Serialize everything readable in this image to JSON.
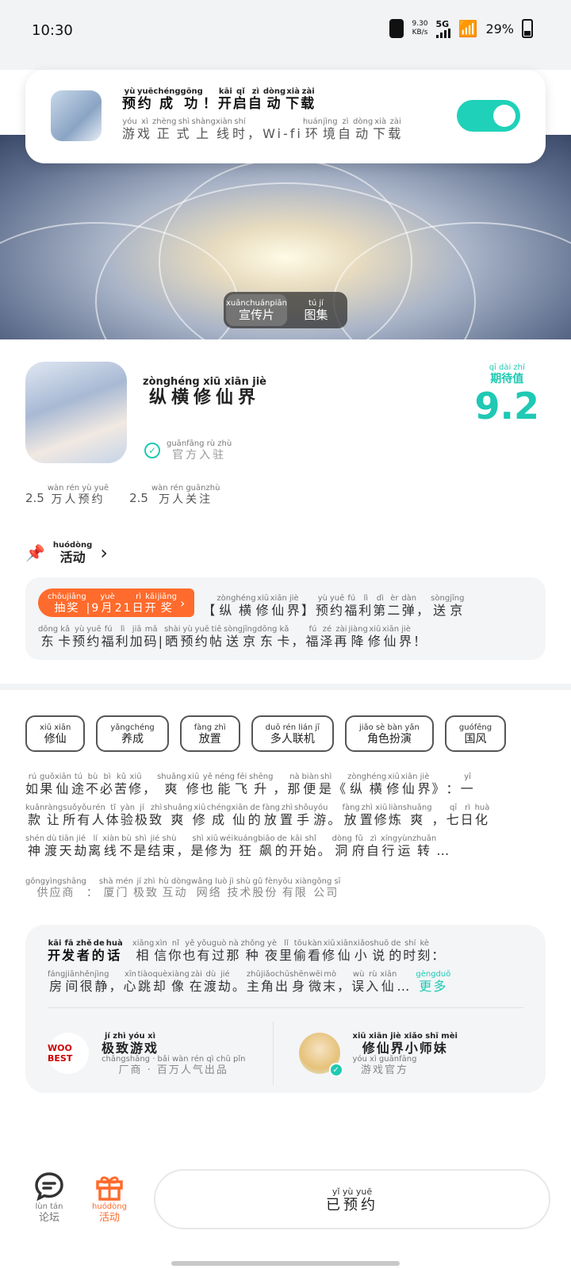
{
  "status_bar": {
    "time": "10:30",
    "net_speed": "9.30",
    "net_unit": "KB/s",
    "network": "5G",
    "battery": "29%"
  },
  "toast": {
    "title": [
      [
        "yù",
        "预"
      ],
      [
        "yuē",
        "约"
      ],
      [
        "chéng",
        "成"
      ],
      [
        "gōng",
        "功"
      ],
      [
        "",
        "！"
      ],
      [
        "kāi",
        "开"
      ],
      [
        "qǐ",
        "启"
      ],
      [
        "zì",
        "自"
      ],
      [
        "dòng",
        "动"
      ],
      [
        "xià",
        "下"
      ],
      [
        "zài",
        "载"
      ]
    ],
    "subtitle": [
      [
        "yóu",
        "游"
      ],
      [
        "xì",
        "戏"
      ],
      [
        "zhèng",
        "正"
      ],
      [
        "shì",
        "式"
      ],
      [
        "shàng",
        "上"
      ],
      [
        "xiàn",
        "线"
      ],
      [
        "shí",
        "时"
      ],
      [
        "",
        "，"
      ],
      [
        "",
        "Wi-fi"
      ],
      [
        "huán",
        "环"
      ],
      [
        "jìng",
        "境"
      ],
      [
        "zì",
        "自"
      ],
      [
        "dòng",
        "动"
      ],
      [
        "xià",
        "下"
      ],
      [
        "zài",
        "载"
      ]
    ],
    "toggle_on": true
  },
  "media_tabs": [
    {
      "pinyin": "xuānchuánpiān",
      "label": "宣传片"
    },
    {
      "pinyin": "tú jí",
      "label": "图集"
    }
  ],
  "game": {
    "name_pinyin": "zònghéng xiū xiān jiè",
    "name": "纵横修仙界",
    "official_pinyin": "guānfāng rù zhù",
    "official": "官方入驻",
    "expect_pinyin": "qī dài zhí",
    "expect_label": "期待值",
    "score": "9.2",
    "stats": [
      {
        "num": "2.5",
        "pinyin": "wàn rén yù yuē",
        "label": "万人预约"
      },
      {
        "num": "2.5",
        "pinyin": "wàn rén guānzhù",
        "label": "万人关注"
      }
    ]
  },
  "activity": {
    "pinyin": "huódòng",
    "title": "活动",
    "badge": [
      [
        "chōujiǎng",
        "抽奖"
      ],
      [
        "",
        "|"
      ],
      [
        "",
        "9"
      ],
      [
        "yuè",
        "月"
      ],
      [
        "",
        "21"
      ],
      [
        "rì",
        "日"
      ],
      [
        "kāi",
        "开"
      ],
      [
        "jiǎng",
        "奖"
      ]
    ],
    "line1": [
      [
        "",
        "【"
      ],
      [
        "zòng",
        "纵"
      ],
      [
        "héng",
        "横"
      ],
      [
        "xiū",
        "修"
      ],
      [
        "xiān",
        "仙"
      ],
      [
        "jiè",
        "界"
      ],
      [
        "",
        "】"
      ],
      [
        "yù",
        "预"
      ],
      [
        "yuē",
        "约"
      ],
      [
        "fú",
        "福"
      ],
      [
        "lì",
        "利"
      ],
      [
        "dì",
        "第"
      ],
      [
        "èr",
        "二"
      ],
      [
        "dàn",
        "弹"
      ],
      [
        "",
        "，"
      ],
      [
        "sòng",
        "送"
      ],
      [
        "jīng",
        "京"
      ]
    ],
    "line2": [
      [
        "dōng",
        "东"
      ],
      [
        "kǎ",
        "卡"
      ],
      [
        "yù",
        "预"
      ],
      [
        "yuē",
        "约"
      ],
      [
        "fú",
        "福"
      ],
      [
        "lì",
        "利"
      ],
      [
        "jiā",
        "加"
      ],
      [
        "mǎ",
        "码"
      ],
      [
        "",
        "|"
      ],
      [
        "shài",
        "晒"
      ],
      [
        "yù",
        "预"
      ],
      [
        "yuē",
        "约"
      ],
      [
        "tiē",
        "帖"
      ],
      [
        "sòng",
        "送"
      ],
      [
        "jīng",
        "京"
      ],
      [
        "dōng",
        "东"
      ],
      [
        "kǎ",
        "卡"
      ],
      [
        "",
        "，"
      ],
      [
        "fú",
        "福"
      ],
      [
        "zé",
        "泽"
      ],
      [
        "zài",
        "再"
      ],
      [
        "jiàng",
        "降"
      ],
      [
        "xiū",
        "修"
      ],
      [
        "xiān",
        "仙"
      ],
      [
        "jiè",
        "界"
      ],
      [
        "",
        "！"
      ]
    ]
  },
  "tags": [
    {
      "pinyin": "xiū xiān",
      "label": "修仙"
    },
    {
      "pinyin": "yǎngchéng",
      "label": "养成"
    },
    {
      "pinyin": "fàng zhì",
      "label": "放置"
    },
    {
      "pinyin": "duō rén lián jī",
      "label": "多人联机"
    },
    {
      "pinyin": "jiǎo sè bàn yǎn",
      "label": "角色扮演"
    },
    {
      "pinyin": "guófēng",
      "label": "国风"
    }
  ],
  "description": [
    [
      [
        "rú",
        "如"
      ],
      [
        "guǒ",
        "果"
      ],
      [
        "xiān",
        "仙"
      ],
      [
        "tú",
        "途"
      ],
      [
        "bù",
        "不"
      ],
      [
        "bì",
        "必"
      ],
      [
        "kǔ",
        "苦"
      ],
      [
        "xiū",
        "修"
      ],
      [
        "",
        "，"
      ],
      [
        "shuǎng",
        "爽"
      ],
      [
        "xiū",
        "修"
      ],
      [
        "yě",
        "也"
      ],
      [
        "néng",
        "能"
      ],
      [
        "fēi",
        "飞"
      ],
      [
        "shēng",
        "升"
      ],
      [
        "",
        "，"
      ],
      [
        "nà",
        "那"
      ],
      [
        "biàn",
        "便"
      ],
      [
        "shì",
        "是"
      ],
      [
        "",
        "《"
      ],
      [
        "zòng",
        "纵"
      ],
      [
        "héng",
        "横"
      ],
      [
        "xiū",
        "修"
      ],
      [
        "xiān",
        "仙"
      ],
      [
        "jiè",
        "界"
      ],
      [
        "",
        "》"
      ],
      [
        "",
        "："
      ],
      [
        "yī",
        "一"
      ]
    ],
    [
      [
        "kuǎn",
        "款"
      ],
      [
        "ràng",
        "让"
      ],
      [
        "suǒ",
        "所"
      ],
      [
        "yǒu",
        "有"
      ],
      [
        "rén",
        "人"
      ],
      [
        "tǐ",
        "体"
      ],
      [
        "yàn",
        "验"
      ],
      [
        "jí",
        "极"
      ],
      [
        "zhì",
        "致"
      ],
      [
        "shuǎng",
        "爽"
      ],
      [
        "xiū",
        "修"
      ],
      [
        "chéng",
        "成"
      ],
      [
        "xiān",
        "仙"
      ],
      [
        "de",
        "的"
      ],
      [
        "fàng",
        "放"
      ],
      [
        "zhì",
        "置"
      ],
      [
        "shǒu",
        "手"
      ],
      [
        "yóu",
        "游"
      ],
      [
        "",
        "。"
      ],
      [
        "fàng",
        "放"
      ],
      [
        "zhì",
        "置"
      ],
      [
        "xiū",
        "修"
      ],
      [
        "liàn",
        "炼"
      ],
      [
        "shuǎng",
        "爽"
      ],
      [
        "",
        "，"
      ],
      [
        "qī",
        "七"
      ],
      [
        "rì",
        "日"
      ],
      [
        "huà",
        "化"
      ]
    ],
    [
      [
        "shén",
        "神"
      ],
      [
        "dù",
        "渡"
      ],
      [
        "tiān",
        "天"
      ],
      [
        "jié",
        "劫"
      ],
      [
        "lí",
        "离"
      ],
      [
        "xiàn",
        "线"
      ],
      [
        "bù",
        "不"
      ],
      [
        "shì",
        "是"
      ],
      [
        "jié",
        "结"
      ],
      [
        "shù",
        "束"
      ],
      [
        "",
        "，"
      ],
      [
        "shì",
        "是"
      ],
      [
        "xiū",
        "修"
      ],
      [
        "wéi",
        "为"
      ],
      [
        "kuáng",
        "狂"
      ],
      [
        "biāo",
        "飙"
      ],
      [
        "de",
        "的"
      ],
      [
        "kāi",
        "开"
      ],
      [
        "shǐ",
        "始"
      ],
      [
        "",
        "。"
      ],
      [
        "dòng",
        "洞"
      ],
      [
        "fǔ",
        "府"
      ],
      [
        "zì",
        "自"
      ],
      [
        "xíng",
        "行"
      ],
      [
        "yùn",
        "运"
      ],
      [
        "zhuǎn",
        "转"
      ],
      [
        "",
        "…"
      ]
    ]
  ],
  "supplier": [
    [
      "gōngyìngshāng",
      "供应商"
    ],
    [
      "",
      "："
    ],
    [
      "shà mén",
      "厦门"
    ],
    [
      "jí zhì",
      "极致"
    ],
    [
      "hù dòng",
      "互动"
    ],
    [
      "wǎng luò",
      "网络"
    ],
    [
      "jì shù",
      "技术"
    ],
    [
      "gǔ fèn",
      "股份"
    ],
    [
      "yǒu xiàn",
      "有限"
    ],
    [
      "gōng sī",
      "公司"
    ]
  ],
  "developer": {
    "title": [
      [
        "kāi",
        "开"
      ],
      [
        "fā",
        "发"
      ],
      [
        "zhě",
        "者"
      ],
      [
        "de",
        "的"
      ],
      [
        "huà",
        "话"
      ]
    ],
    "line1": [
      [
        "xiāng",
        "相"
      ],
      [
        "xìn",
        "信"
      ],
      [
        "nǐ",
        "你"
      ],
      [
        "yě",
        "也"
      ],
      [
        "yǒu",
        "有"
      ],
      [
        "guò",
        "过"
      ],
      [
        "nà",
        "那"
      ],
      [
        "zhǒng",
        "种"
      ],
      [
        "yè",
        "夜"
      ],
      [
        "lǐ",
        "里"
      ],
      [
        "tōu",
        "偷"
      ],
      [
        "kàn",
        "看"
      ],
      [
        "xiū",
        "修"
      ],
      [
        "xiān",
        "仙"
      ],
      [
        "xiǎo",
        "小"
      ],
      [
        "shuō",
        "说"
      ],
      [
        "de",
        "的"
      ],
      [
        "shí",
        "时"
      ],
      [
        "kè",
        "刻"
      ],
      [
        "",
        "："
      ]
    ],
    "line2": [
      [
        "fáng",
        "房"
      ],
      [
        "jiān",
        "间"
      ],
      [
        "hěn",
        "很"
      ],
      [
        "jìng",
        "静"
      ],
      [
        "",
        "，"
      ],
      [
        "xīn",
        "心"
      ],
      [
        "tiào",
        "跳"
      ],
      [
        "què",
        "却"
      ],
      [
        "xiàng",
        "像"
      ],
      [
        "zài",
        "在"
      ],
      [
        "dù",
        "渡"
      ],
      [
        "jié",
        "劫"
      ],
      [
        "",
        "。"
      ],
      [
        "zhǔ",
        "主"
      ],
      [
        "jiǎo",
        "角"
      ],
      [
        "chū",
        "出"
      ],
      [
        "shēn",
        "身"
      ],
      [
        "wēi",
        "微"
      ],
      [
        "mò",
        "末"
      ],
      [
        "",
        "，"
      ],
      [
        "wù",
        "误"
      ],
      [
        "rù",
        "入"
      ],
      [
        "xiān",
        "仙"
      ],
      [
        "",
        "…"
      ]
    ],
    "more_pinyin": "gèngduō",
    "more": "更多",
    "people": [
      {
        "avatar": "WOO BEST",
        "pinyin": "jí zhì yóu xì",
        "name": "极致游戏",
        "sub_pinyin": "chǎngshāng · bǎi wàn rén qì chū pǐn",
        "sub": "厂商 · 百万人气出品"
      },
      {
        "avatar": "",
        "pinyin": "xiū xiān jiè xiǎo shī mèi",
        "name": "修仙界小师妹",
        "sub_pinyin": "yóu xì guānfāng",
        "sub": "游戏官方"
      }
    ]
  },
  "bottom_nav": {
    "forum_pinyin": "lùn tán",
    "forum": "论坛",
    "activity_pinyin": "huódòng",
    "activity": "活动",
    "reserve_pinyin": "yǐ yù yuē",
    "reserve": "已预约"
  },
  "colors": {
    "accent": "#1fc9b3",
    "orange": "#ff6b2c",
    "toggle": "#1fd1b8"
  }
}
